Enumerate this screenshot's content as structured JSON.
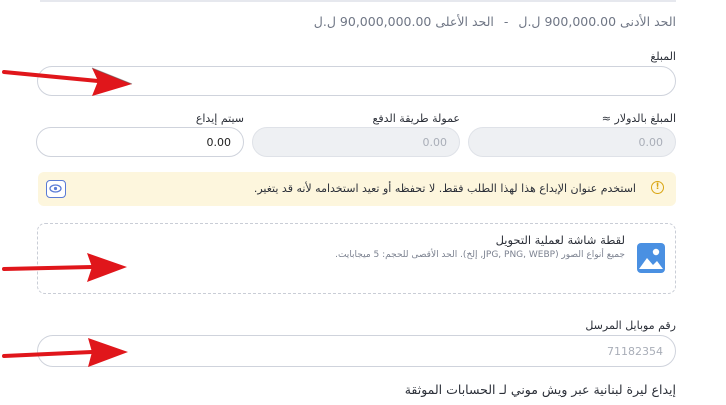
{
  "limits": {
    "min_label": "الحد الأدنى",
    "min_value": "900,000.00 ل.ل",
    "separator": "-",
    "max_label": "الحد الأعلى",
    "max_value": "90,000,000.00 ل.ل"
  },
  "amount": {
    "label": "المبلغ",
    "value": "",
    "placeholder": ""
  },
  "usd_amount": {
    "label": "المبلغ بالدولار ≈",
    "value": "",
    "placeholder": "0.00"
  },
  "fee": {
    "label": "عمولة طريقة الدفع",
    "value": "",
    "placeholder": "0.00"
  },
  "deposit": {
    "label": "سيتم إيداع",
    "value": "0.00"
  },
  "notice": {
    "text": "استخدم عنوان الإيداع هذا لهذا الطلب فقط. لا تحفظه أو تعيد استخدامه لأنه قد يتغير."
  },
  "upload": {
    "title": "لقطة شاشة لعملية التحويل",
    "subtitle": "جميع أنواع الصور (JPG, PNG, WEBP, إلخ). الحد الأقصى للحجم: 5 ميجابايت."
  },
  "sender_mobile": {
    "label": "رقم موبايل المرسل",
    "value": "",
    "placeholder": "71182354"
  },
  "section_heading": "إيداع ليرة لبنانية عبر ويش موني لـ الحسابات الموثقة",
  "colors": {
    "accent": "#5a7bd6",
    "warning": "#d9a512",
    "notice_bg": "#fdf6dd",
    "arrow": "#e0161b"
  }
}
